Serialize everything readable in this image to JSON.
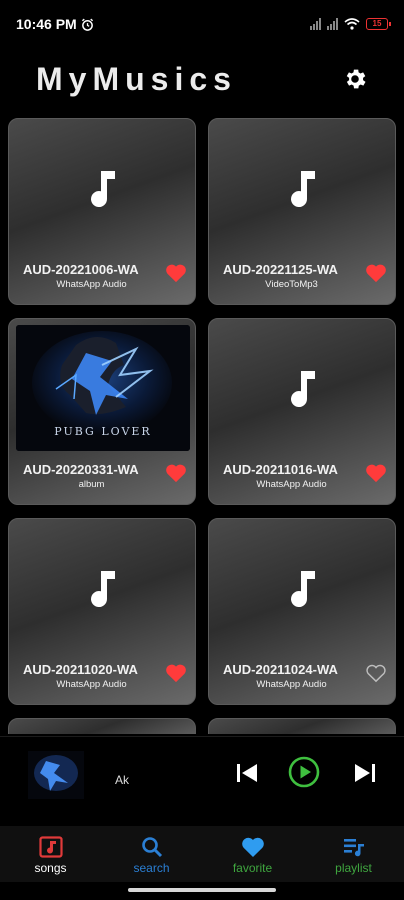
{
  "status_bar": {
    "time": "10:46 PM",
    "battery": "15"
  },
  "header": {
    "title": "MyMusics"
  },
  "songs": [
    {
      "title": "AUD-20221006-WA",
      "subtitle": "WhatsApp Audio",
      "favorite": true,
      "has_artwork": false
    },
    {
      "title": "AUD-20221125-WA",
      "subtitle": "VideoToMp3",
      "favorite": true,
      "has_artwork": false
    },
    {
      "title": "AUD-20220331-WA",
      "subtitle": "album",
      "favorite": true,
      "has_artwork": true,
      "artwork_text": "PUBG LOVER"
    },
    {
      "title": "AUD-20211016-WA",
      "subtitle": "WhatsApp Audio",
      "favorite": true,
      "has_artwork": false
    },
    {
      "title": "AUD-20211020-WA",
      "subtitle": "WhatsApp Audio",
      "favorite": true,
      "has_artwork": false
    },
    {
      "title": "AUD-20211024-WA",
      "subtitle": "WhatsApp Audio",
      "favorite": false,
      "has_artwork": false
    }
  ],
  "player": {
    "track_name": "Ak"
  },
  "nav": {
    "items": [
      {
        "label": "songs",
        "icon": "music-note-box-icon",
        "color": "#e03a3a",
        "label_color": "#ffffff"
      },
      {
        "label": "search",
        "icon": "search-icon",
        "color": "#2b7fd4",
        "label_color": "#2b7fd4"
      },
      {
        "label": "favorite",
        "icon": "heart-icon",
        "color": "#2f9cf0",
        "label_color": "#3fa63f"
      },
      {
        "label": "playlist",
        "icon": "playlist-icon",
        "color": "#2b7fd4",
        "label_color": "#3fa63f"
      }
    ]
  },
  "colors": {
    "favorite": "#ff3b3b",
    "play_ring": "#3fbf3f",
    "accent": "#2b7fd4"
  }
}
